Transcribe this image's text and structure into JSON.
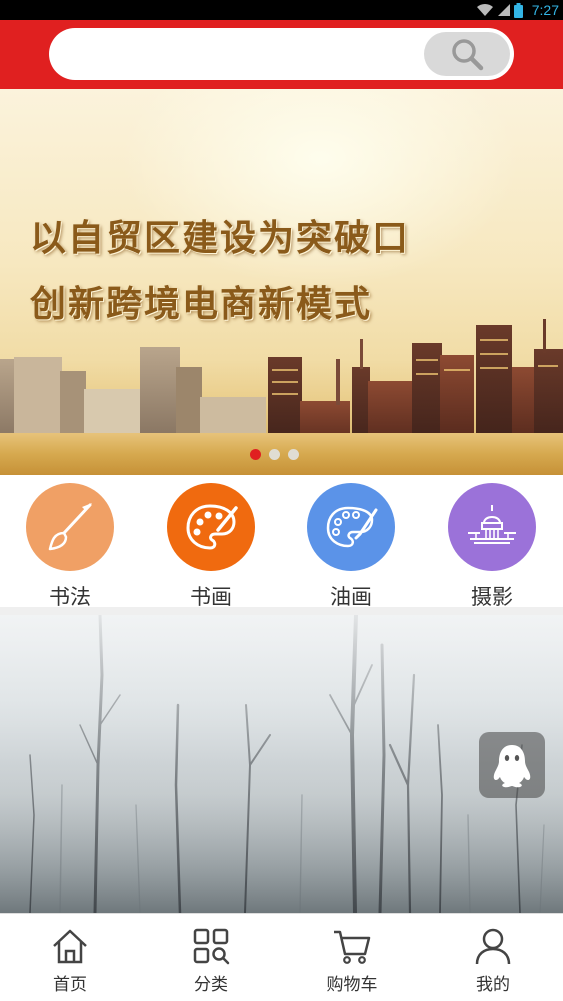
{
  "status_bar": {
    "time": "7:27",
    "icons": [
      "wifi-icon",
      "signal-icon",
      "battery-icon"
    ]
  },
  "header": {
    "search": {
      "placeholder": "",
      "button_icon": "search-icon"
    },
    "background_color": "#e02020"
  },
  "banner": {
    "headline_line1": "以自贸区建设为突破口",
    "headline_line2": "创新跨境电商新模式",
    "slide_count": 3,
    "active_slide": 1
  },
  "categories": [
    {
      "label": "书法",
      "icon": "brush-icon",
      "color": "#f0a065"
    },
    {
      "label": "书画",
      "icon": "palette-icon",
      "color": "#f06a0f"
    },
    {
      "label": "油画",
      "icon": "paint-palette-icon",
      "color": "#5b93e8"
    },
    {
      "label": "摄影",
      "icon": "capitol-building-icon",
      "color": "#9b72d9"
    }
  ],
  "floating_button": {
    "icon": "qq-penguin-icon"
  },
  "tabbar": [
    {
      "label": "首页",
      "icon": "home-icon"
    },
    {
      "label": "分类",
      "icon": "category-grid-icon"
    },
    {
      "label": "购物车",
      "icon": "cart-icon"
    },
    {
      "label": "我的",
      "icon": "user-icon"
    }
  ]
}
